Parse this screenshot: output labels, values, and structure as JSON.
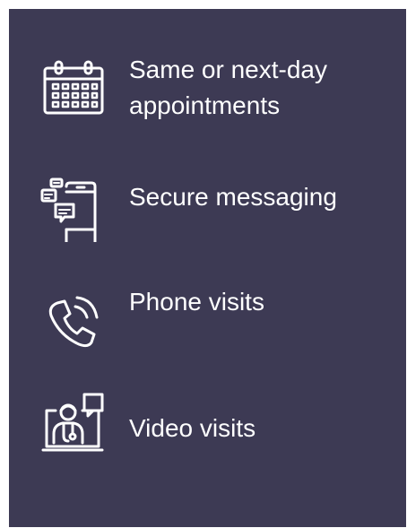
{
  "features": [
    {
      "label_line1": "Same or next-day",
      "label_line2": "appointments",
      "icon": "calendar-icon"
    },
    {
      "label": "Secure messaging",
      "icon": "mobile-chat-icon"
    },
    {
      "label": "Phone visits",
      "icon": "phone-icon"
    },
    {
      "label": "Video visits",
      "icon": "video-doctor-icon"
    }
  ],
  "colors": {
    "panel_background": "#3d3a54",
    "text": "#ffffff",
    "icon_stroke": "#ffffff"
  }
}
